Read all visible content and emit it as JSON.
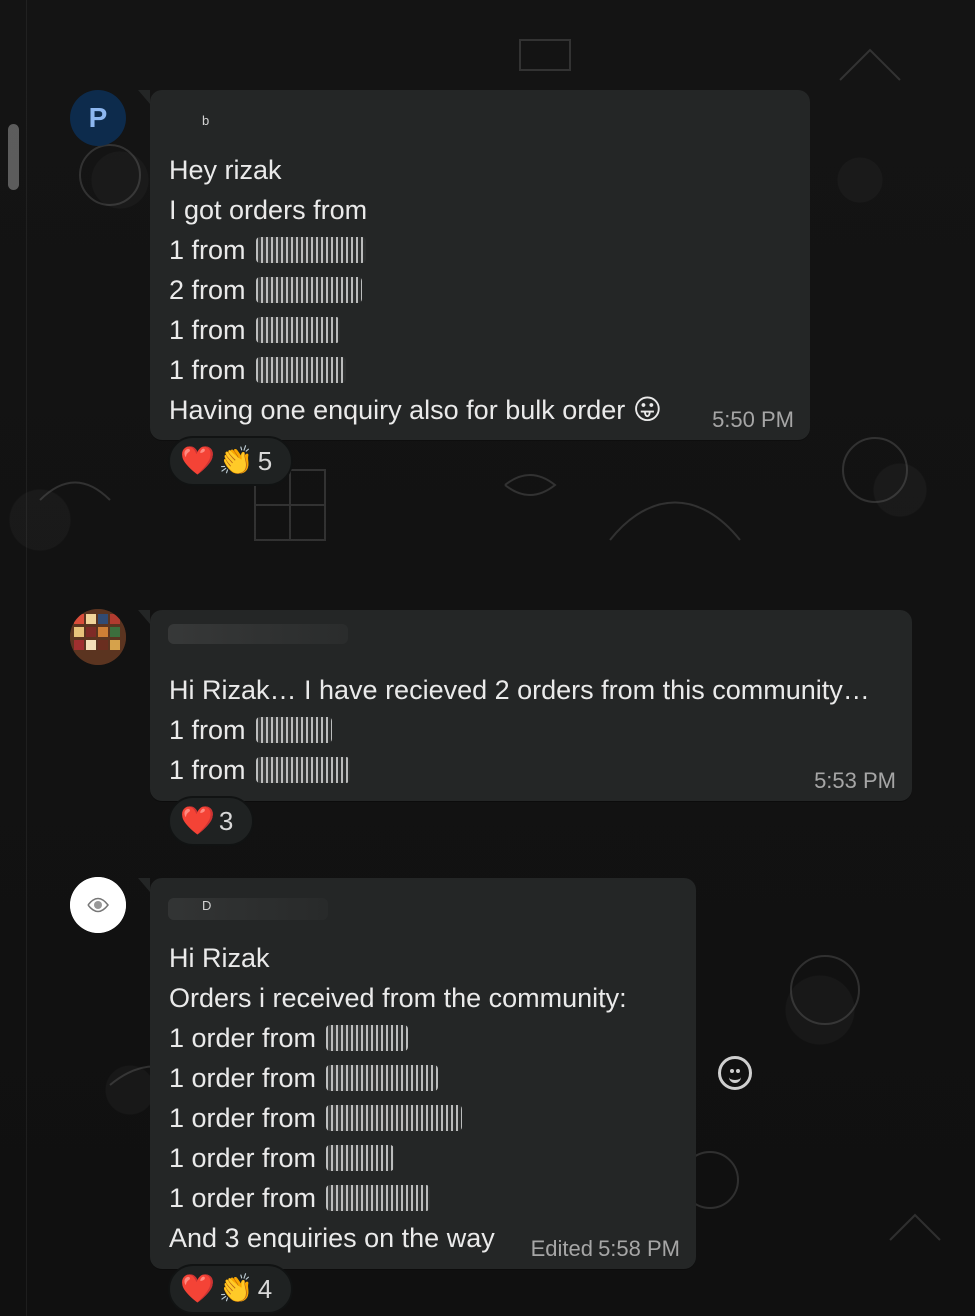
{
  "chat": {
    "messages": [
      {
        "avatar_letter": "P",
        "sender": "b",
        "lines": [
          "Hey rizak",
          "I got orders  from",
          "1 from",
          "2 from",
          "1 from",
          "1 from",
          "Having one enquiry also for bulk order"
        ],
        "emoji": "😛",
        "time": "5:50 PM",
        "reactions": {
          "heart": "❤️",
          "clap": "👏",
          "count": "5"
        }
      },
      {
        "lines": [
          "Hi Rizak… I have recieved 2 orders from this community…",
          "1 from",
          "1 from"
        ],
        "time": "5:53 PM",
        "reactions": {
          "heart": "❤️",
          "count": "3"
        }
      },
      {
        "sender": "D",
        "lines": [
          "Hi Rizak",
          "Orders i received from the community:",
          "1 order from",
          "1 order from",
          "1 order from",
          "1 order from",
          "1 order from",
          "And 3 enquiries on the way"
        ],
        "edited_label": "Edited",
        "time": "5:58 PM",
        "reactions": {
          "heart": "❤️",
          "clap": "👏",
          "count": "4"
        }
      }
    ]
  },
  "icons": {
    "emoji_button": "smile-icon"
  }
}
